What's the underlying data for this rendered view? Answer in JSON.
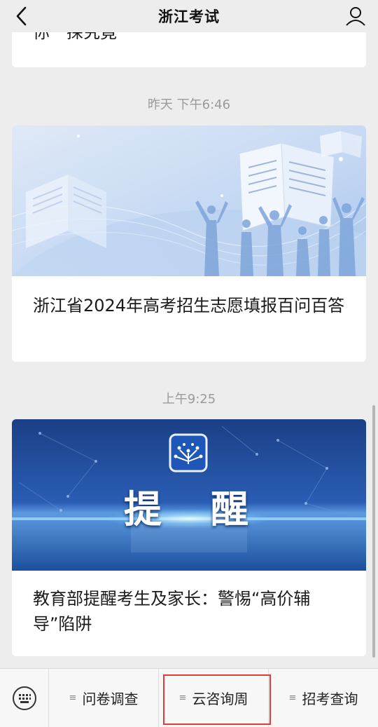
{
  "header": {
    "title": "浙江考试"
  },
  "feed": {
    "cut_off_title": "你一探究竟",
    "items": [
      {
        "time": "昨天 下午6:46",
        "title": "浙江省2024年高考招生志愿填报百问百答"
      },
      {
        "time": "上午9:25",
        "banner_text": "提　醒",
        "title": "教育部提醒考生及家长：警惕“高价辅导”陷阱"
      }
    ]
  },
  "menu": {
    "items": [
      {
        "label": "问卷调查"
      },
      {
        "label": "云咨询周"
      },
      {
        "label": "招考查询"
      }
    ],
    "highlight_color": "#e23b3b"
  },
  "colors": {
    "background": "#ededed",
    "card": "#ffffff",
    "timestamp_text": "#9a9a9a",
    "banner_blue": "#1d4f9c"
  }
}
